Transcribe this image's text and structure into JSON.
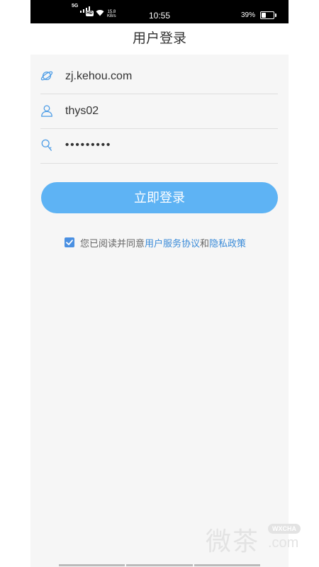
{
  "status_bar": {
    "signal_label": "5G",
    "hd_label": "HD",
    "speed_value": "15.8",
    "speed_unit": "KB/s",
    "time": "10:55",
    "battery_percent": "39%",
    "battery_level": 0.39
  },
  "nav": {
    "title": "用户登录"
  },
  "form": {
    "domain_value": "zj.kehou.com",
    "username_value": "thys02",
    "password_value": "•••••••••"
  },
  "login_button": "立即登录",
  "agreement": {
    "checked": true,
    "prefix": "您已阅读并同意",
    "terms_link": "用户服务协议",
    "connector": "和",
    "privacy_link": "隐私政策"
  },
  "watermark": {
    "chinese": "微茶",
    "badge": "WXCHA",
    "suffix": ".com"
  },
  "colors": {
    "accent": "#5eb3f4",
    "link": "#3a8bd8",
    "icon": "#4a9be6",
    "background": "#f6f6f6"
  },
  "icons": [
    "planet-icon",
    "user-icon",
    "key-icon",
    "checkbox-checked-icon",
    "wifi-icon",
    "battery-icon"
  ]
}
